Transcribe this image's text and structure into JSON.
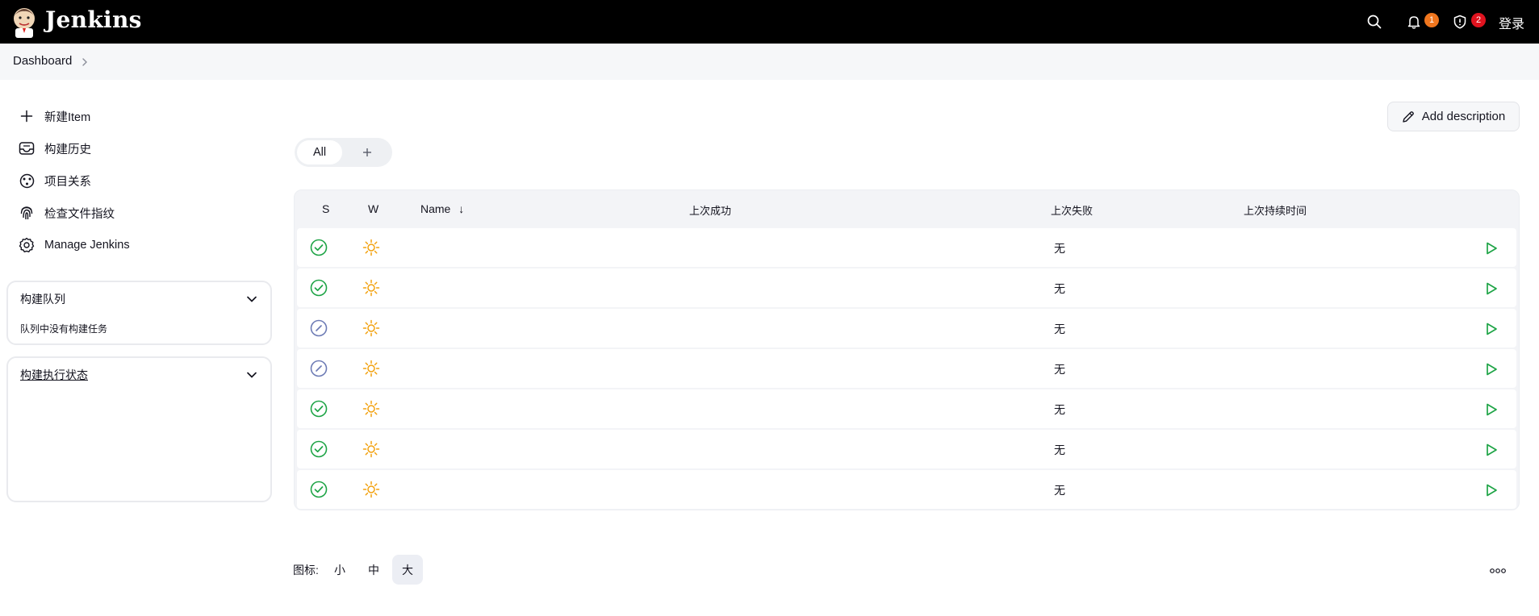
{
  "header": {
    "brand": "Jenkins",
    "notifications_count": "1",
    "security_count": "2",
    "login_label": "登录",
    "notifications_badge_color": "#f0761e",
    "security_badge_color": "#e0131f"
  },
  "breadcrumb": {
    "items": [
      "Dashboard"
    ]
  },
  "sidebar": {
    "tasks": [
      {
        "label": "新建Item",
        "icon": "plus-icon"
      },
      {
        "label": "构建历史",
        "icon": "inbox-icon"
      },
      {
        "label": "项目关系",
        "icon": "relationship-icon"
      },
      {
        "label": "检查文件指纹",
        "icon": "fingerprint-icon"
      },
      {
        "label": "Manage Jenkins",
        "icon": "gear-icon"
      }
    ],
    "build_queue": {
      "title": "构建队列",
      "empty_text": "队列中没有构建任务"
    },
    "executor_status": {
      "title": "构建执行状态"
    }
  },
  "main": {
    "add_description_label": "Add description",
    "tabs": [
      {
        "label": "All"
      }
    ],
    "table": {
      "headers": {
        "s": "S",
        "w": "W",
        "name": "Name",
        "sort_arrow": "↓",
        "last_success": "上次成功",
        "last_failure": "上次失败",
        "last_duration": "上次持续时间"
      },
      "rows": [
        {
          "status": "success",
          "weather": "sunny",
          "last_failure": "无"
        },
        {
          "status": "success",
          "weather": "sunny",
          "last_failure": "无"
        },
        {
          "status": "disabled",
          "weather": "sunny",
          "last_failure": "无"
        },
        {
          "status": "disabled",
          "weather": "sunny",
          "last_failure": "无"
        },
        {
          "status": "success",
          "weather": "sunny",
          "last_failure": "无"
        },
        {
          "status": "success",
          "weather": "sunny",
          "last_failure": "无"
        },
        {
          "status": "success",
          "weather": "sunny",
          "last_failure": "无"
        }
      ]
    },
    "icon_legend": {
      "label": "图标:",
      "sizes": [
        "小",
        "中",
        "大"
      ],
      "selected": "大"
    }
  },
  "colors": {
    "success": "#1ea446",
    "disabled": "#6d7bb5",
    "weather": "#f2a10e",
    "run": "#1ea446"
  }
}
